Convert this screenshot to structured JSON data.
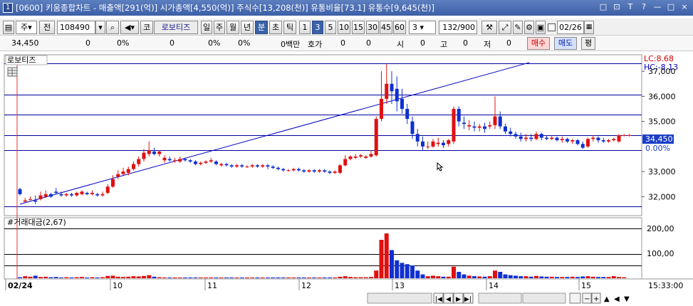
{
  "window": {
    "number": "1",
    "title": "[0600] 키움종합차트 - 매출액[291(억)] 시가총액[4,550(억)] 주식수[13,208(천)] 유통비율[73.1] 유통수[9,645(천)]",
    "controls": [
      "□",
      "⊡",
      "T",
      "?",
      "—",
      "□",
      "×"
    ]
  },
  "toolbar": {
    "market": "주",
    "prev_label": "전",
    "code": "108490",
    "search_icon": "search-icon",
    "speaker": "◀▾",
    "exchange": "코",
    "stock_name": "로보티즈",
    "periods": [
      "일",
      "주",
      "월",
      "년",
      "분",
      "초",
      "틱"
    ],
    "selected_period": "분",
    "intervals": [
      "1",
      "3",
      "5",
      "10",
      "15",
      "30",
      "45",
      "60"
    ],
    "selected_interval": "3",
    "interval_value": "3",
    "count": "132",
    "count_total": "/900",
    "date": "02/26",
    "date_checkbox": false
  },
  "quote": {
    "price": "34,450",
    "change": "0",
    "pct1": "0%",
    "v1": "0",
    "pct2": "0%",
    "pct3": "0%",
    "amount": "0백만",
    "hoga_label": "호가",
    "hoga": "0",
    "v2": "0",
    "si_label": "시",
    "si": "0",
    "go_label": "고",
    "go": "0",
    "jeo_label": "저",
    "jeo": "0",
    "buy_label": "매수",
    "sell_label": "매도",
    "avg_label": "평"
  },
  "chart_panel": {
    "name_label": "로보티즈",
    "lc": "LC:8.68",
    "hc": "HC:-8.13",
    "price_ticks": [
      "37,000",
      "36,000",
      "35,000",
      "34,450",
      "0.00%",
      "33,000",
      "32,000"
    ],
    "volume_label": "#거래대금(2,67)",
    "volume_ticks": [
      "200,00",
      "100,00"
    ],
    "time_labels": [
      "02/24",
      "10",
      "11",
      "12",
      "13",
      "14",
      "15"
    ],
    "time_right": "15:33:00"
  },
  "chart_data": {
    "type": "candlestick",
    "ylim": [
      31300,
      37600
    ],
    "h_lines": [
      37330,
      36080,
      35260,
      34450,
      33850,
      31600
    ],
    "current_price": 34450,
    "candles": [
      [
        32300,
        32350,
        32100,
        32050
      ],
      [
        31800,
        31950,
        31850,
        31750
      ],
      [
        31900,
        32000,
        31900,
        31850
      ],
      [
        31850,
        32050,
        31800,
        31700
      ],
      [
        31900,
        32200,
        32050,
        31850
      ],
      [
        32000,
        32250,
        32100,
        31950
      ],
      [
        32100,
        32150,
        32000,
        31950
      ],
      [
        32200,
        32350,
        32150,
        32100
      ],
      [
        32100,
        32200,
        32050,
        32000
      ],
      [
        32050,
        32150,
        32100,
        32000
      ],
      [
        32100,
        32150,
        32050,
        32000
      ],
      [
        32050,
        32200,
        32150,
        32000
      ],
      [
        32100,
        32250,
        32200,
        32050
      ],
      [
        32150,
        32200,
        32100,
        32050
      ],
      [
        32100,
        32250,
        32150,
        32050
      ],
      [
        32100,
        32150,
        32050,
        32000
      ],
      [
        32050,
        32200,
        32100,
        32000
      ],
      [
        32150,
        32500,
        32400,
        32100
      ],
      [
        32400,
        32850,
        32700,
        32350
      ],
      [
        32800,
        33050,
        32900,
        32700
      ],
      [
        32900,
        33150,
        33000,
        32850
      ],
      [
        32950,
        33200,
        33100,
        32850
      ],
      [
        33100,
        33400,
        33300,
        33050
      ],
      [
        33300,
        33600,
        33500,
        33200
      ],
      [
        33500,
        33900,
        33750,
        33400
      ],
      [
        33700,
        34200,
        33850,
        33600
      ],
      [
        33800,
        33950,
        33700,
        33650
      ],
      [
        33700,
        33850,
        33800,
        33600
      ],
      [
        33450,
        33650,
        33550,
        33350
      ],
      [
        33500,
        33600,
        33450,
        33400
      ],
      [
        33450,
        33550,
        33450,
        33350
      ],
      [
        33400,
        33600,
        33500,
        33350
      ],
      [
        33500,
        33550,
        33450,
        33400
      ],
      [
        33450,
        33500,
        33400,
        33350
      ],
      [
        33400,
        33450,
        33300,
        33250
      ],
      [
        33300,
        33400,
        33350,
        33250
      ],
      [
        33350,
        33450,
        33400,
        33300
      ],
      [
        33400,
        33550,
        33450,
        33350
      ],
      [
        33400,
        33450,
        33300,
        33250
      ],
      [
        33250,
        33350,
        33300,
        33200
      ],
      [
        33300,
        33350,
        33250,
        33200
      ],
      [
        33250,
        33300,
        33200,
        33150
      ],
      [
        33200,
        33300,
        33250,
        33150
      ],
      [
        33250,
        33300,
        33200,
        33150
      ],
      [
        33200,
        33250,
        33200,
        33150
      ],
      [
        33200,
        33300,
        33250,
        33150
      ],
      [
        33250,
        33300,
        33200,
        33150
      ],
      [
        33200,
        33300,
        33250,
        33150
      ],
      [
        33250,
        33300,
        33200,
        33100
      ],
      [
        33200,
        33250,
        33150,
        33100
      ],
      [
        33150,
        33200,
        33100,
        33050
      ],
      [
        33100,
        33150,
        33050,
        33000
      ],
      [
        33050,
        33100,
        33050,
        33000
      ],
      [
        33050,
        33150,
        33100,
        33000
      ],
      [
        33100,
        33150,
        33050,
        33000
      ],
      [
        33050,
        33100,
        33000,
        32950
      ],
      [
        33000,
        33100,
        33050,
        32950
      ],
      [
        33050,
        33100,
        33000,
        32950
      ],
      [
        33000,
        33100,
        33050,
        32950
      ],
      [
        33050,
        33100,
        33000,
        32950
      ],
      [
        33000,
        33050,
        32950,
        32900
      ],
      [
        32950,
        33050,
        33000,
        32900
      ],
      [
        32950,
        33300,
        33250,
        32900
      ],
      [
        33250,
        33650,
        33500,
        33200
      ],
      [
        33500,
        33650,
        33600,
        33450
      ],
      [
        33550,
        33700,
        33600,
        33500
      ],
      [
        33600,
        33700,
        33650,
        33550
      ],
      [
        33550,
        33650,
        33600,
        33500
      ],
      [
        33600,
        33850,
        33700,
        33550
      ],
      [
        33650,
        35200,
        35100,
        33600
      ],
      [
        35100,
        37000,
        35900,
        35000
      ],
      [
        35900,
        37300,
        36500,
        35700
      ],
      [
        36500,
        37000,
        36200,
        35700
      ],
      [
        36300,
        36800,
        35800,
        35400
      ],
      [
        35900,
        36300,
        35500,
        35300
      ],
      [
        35500,
        35700,
        35100,
        34900
      ],
      [
        35000,
        35200,
        34500,
        34300
      ],
      [
        34500,
        34700,
        34200,
        34000
      ],
      [
        34200,
        34400,
        34000,
        33850
      ],
      [
        34000,
        34200,
        34000,
        33900
      ],
      [
        34000,
        34300,
        34200,
        33950
      ],
      [
        34100,
        34350,
        34150,
        34000
      ],
      [
        34150,
        34250,
        34050,
        33950
      ],
      [
        34100,
        34300,
        34250,
        34000
      ],
      [
        34200,
        35600,
        35500,
        34100
      ],
      [
        35500,
        35600,
        35000,
        34800
      ],
      [
        34950,
        35200,
        34900,
        34700
      ],
      [
        34800,
        35050,
        34850,
        34650
      ],
      [
        34800,
        35000,
        34750,
        34600
      ],
      [
        34750,
        34900,
        34800,
        34600
      ],
      [
        34800,
        34950,
        34700,
        34550
      ],
      [
        34800,
        35000,
        34850,
        34700
      ],
      [
        34850,
        36000,
        35200,
        34700
      ],
      [
        35200,
        35400,
        34800,
        34700
      ],
      [
        34800,
        34900,
        34600,
        34500
      ],
      [
        34600,
        34750,
        34500,
        34400
      ],
      [
        34500,
        34600,
        34400,
        34300
      ],
      [
        34400,
        34550,
        34300,
        34200
      ],
      [
        34300,
        34500,
        34350,
        34200
      ],
      [
        34350,
        34500,
        34300,
        34200
      ],
      [
        34300,
        34600,
        34500,
        34250
      ],
      [
        34500,
        34550,
        34350,
        34250
      ],
      [
        34350,
        34450,
        34300,
        34250
      ],
      [
        34300,
        34450,
        34350,
        34250
      ],
      [
        34350,
        34400,
        34250,
        34200
      ],
      [
        34250,
        34400,
        34300,
        34150
      ],
      [
        34300,
        34350,
        34200,
        34150
      ],
      [
        34200,
        34300,
        34250,
        34100
      ],
      [
        34250,
        34300,
        34100,
        34050
      ],
      [
        34100,
        34200,
        33950,
        33900
      ],
      [
        34000,
        34350,
        34300,
        33950
      ],
      [
        34300,
        34450,
        34350,
        34200
      ],
      [
        34350,
        34400,
        34250,
        34150
      ],
      [
        34250,
        34350,
        34200,
        34150
      ],
      [
        34200,
        34300,
        34250,
        34150
      ],
      [
        34250,
        34350,
        34300,
        34200
      ],
      [
        34200,
        34500,
        34450,
        34150
      ],
      [
        34450,
        34500,
        34450,
        34400
      ],
      [
        34450,
        34500,
        34450,
        34400
      ]
    ],
    "volumes": [
      4,
      8,
      6,
      10,
      5,
      6,
      4,
      5,
      3,
      4,
      3,
      4,
      5,
      3,
      4,
      3,
      4,
      9,
      10,
      6,
      5,
      6,
      8,
      7,
      9,
      12,
      6,
      4,
      3,
      3,
      3,
      3,
      3,
      3,
      3,
      3,
      3,
      3,
      3,
      3,
      3,
      3,
      3,
      3,
      3,
      3,
      3,
      3,
      3,
      3,
      3,
      3,
      3,
      3,
      3,
      3,
      3,
      3,
      3,
      3,
      3,
      3,
      6,
      8,
      5,
      4,
      4,
      4,
      5,
      30,
      150,
      175,
      110,
      70,
      60,
      55,
      50,
      30,
      15,
      8,
      10,
      8,
      6,
      6,
      45,
      25,
      15,
      10,
      8,
      7,
      6,
      8,
      30,
      25,
      15,
      12,
      10,
      8,
      8,
      6,
      9,
      7,
      6,
      6,
      5,
      5,
      5,
      6,
      5,
      7,
      8,
      6,
      5,
      5,
      5,
      8,
      5,
      4
    ],
    "trendline": [
      [
        0,
        31700
      ],
      [
        118,
        37350
      ]
    ]
  }
}
